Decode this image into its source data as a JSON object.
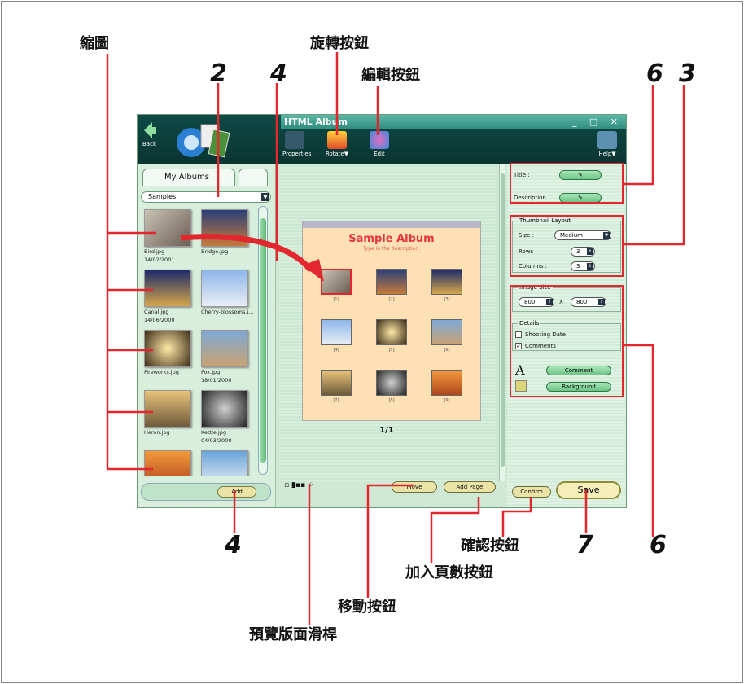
{
  "labels": {
    "thumbnail": "縮圖",
    "rotate_button": "旋轉按鈕",
    "edit_button": "編輯按鈕",
    "confirm_button": "確認按鈕",
    "add_page_button": "加入頁數按鈕",
    "move_button": "移動按鈕",
    "preview_slider": "預覽版面滑桿"
  },
  "numbers": {
    "n2": "2",
    "n4_top": "4",
    "n6_top": "6",
    "n3": "3",
    "n4_bottom": "4",
    "n7": "7",
    "n6_bottom": "6"
  },
  "app": {
    "title": "HTML Album",
    "back": "Back",
    "toolbar": {
      "properties": "Properties",
      "rotate": "Rotate▼",
      "edit": "Edit",
      "help": "Help▼"
    },
    "left": {
      "tab_my_albums": "My Albums",
      "combo_value": "Samples",
      "add": "Add",
      "thumbs": [
        {
          "name": "Bird.jpg",
          "date": "14/02/2001"
        },
        {
          "name": "Bridge.jpg",
          "date": ""
        },
        {
          "name": "Canal.jpg",
          "date": "14/06/2000"
        },
        {
          "name": "Cherry-blossoms.j...",
          "date": ""
        },
        {
          "name": "Fireworks.jpg",
          "date": ""
        },
        {
          "name": "Fox.jpg",
          "date": "18/01/2000"
        },
        {
          "name": "Heron.jpg",
          "date": ""
        },
        {
          "name": "Kettle.jpg",
          "date": "04/03/2000"
        }
      ]
    },
    "center": {
      "page_title": "Sample Album",
      "page_subtitle": "Type in the description.",
      "page_number": "1/1",
      "cells": [
        "[1]",
        "[2]",
        "[3]",
        "[4]",
        "[5]",
        "[6]",
        "[7]",
        "[8]",
        "[9]"
      ],
      "move": "Move",
      "add_page": "Add Page"
    },
    "right": {
      "title": "Title :",
      "description": "Description :",
      "thumbnail_layout": "Thumbnail Layout",
      "size_label": "Size :",
      "size_value": "Medium",
      "rows_label": "Rows :",
      "rows_value": "3",
      "columns_label": "Columns :",
      "columns_value": "3",
      "image_size": "Image Size",
      "width": "800",
      "height": "800",
      "times": "X",
      "details": "Details",
      "shooting_date": "Shooting Date",
      "comments": "Comments",
      "comment_btn": "Comment",
      "background_btn": "Background",
      "confirm": "Confirm",
      "save": "Save"
    }
  }
}
